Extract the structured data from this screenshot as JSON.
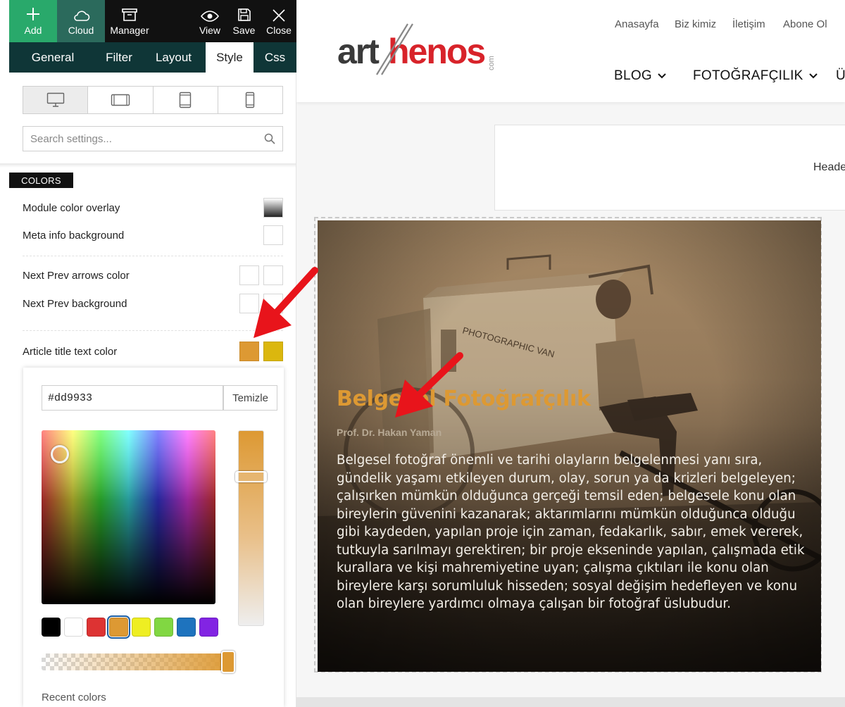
{
  "toolbar": {
    "add_label": "Add",
    "cloud_label": "Cloud",
    "manager_label": "Manager",
    "view_label": "View",
    "save_label": "Save",
    "close_label": "Close"
  },
  "tabs": [
    {
      "label": "General"
    },
    {
      "label": "Filter"
    },
    {
      "label": "Layout"
    },
    {
      "label": "Style",
      "active": true
    },
    {
      "label": "Css"
    }
  ],
  "devices": [
    {
      "icon": "desktop-icon",
      "active": true
    },
    {
      "icon": "tablet-landscape-icon"
    },
    {
      "icon": "tablet-portrait-icon"
    },
    {
      "icon": "phone-icon"
    }
  ],
  "search": {
    "placeholder": "Search settings..."
  },
  "section": {
    "label": "COLORS"
  },
  "settings": {
    "module_overlay": "Module color overlay",
    "meta_bg": "Meta info background",
    "arrows_color": "Next Prev arrows color",
    "arrows_bg": "Next Prev background",
    "title_color": "Article title text color"
  },
  "title_color_swatches": [
    "#dd9933",
    "#dbb70e"
  ],
  "picker": {
    "hex_value": "#dd9933",
    "clear_label": "Temizle",
    "palette": [
      "#000000",
      "#ffffff",
      "#dd3333",
      "#dd9933",
      "#eeee22",
      "#81d742",
      "#1e73be",
      "#8224e3"
    ],
    "selected": "#dd9933",
    "recent_label": "Recent colors"
  },
  "site": {
    "top_links": [
      "Anasayfa",
      "Biz kimiz",
      "İletişim",
      "Abone Ol"
    ],
    "nav": [
      "BLOG",
      "FOTOĞRAFÇILIK",
      "Ü"
    ],
    "header_box_text": "Heade",
    "logo": {
      "part1": "art",
      "part2": "henos",
      "suffix": "com"
    }
  },
  "article": {
    "title": "Belgesel Fotoğrafçılık",
    "author": "Prof. Dr. Hakan Yaman",
    "text": "Belgesel fotoğraf önemli ve tarihi olayların belgelenmesi yanı sıra, gündelik yaşamı etkileyen durum, olay, sorun ya da krizleri belgeleyen; çalışırken mümkün olduğunca gerçeği temsil eden; belgesele konu olan bireylerin güvenini kazanarak; aktarımlarını mümkün olduğunca olduğu gibi kaydeden, yapılan proje için zaman, fedakarlık, sabır, emek vererek, tutkuyla sarılmayı gerektiren; bir proje ekseninde yapılan, çalışmada etik kurallara ve kişi mahremiyetine uyan; çalışma çıktıları ile konu olan bireylere karşı sorumluluk hisseden; sosyal değişim hedefleyen ve konu olan bireylere yardımcı olmaya çalışan bir fotoğraf üslubudur.",
    "photo_caption": "PHOTOGRAPHIC VAN"
  },
  "colors": {
    "accent": "#dd9933",
    "topbar": "#111111",
    "tabs_bg": "#0f3637",
    "add_bg": "#29a96b",
    "cloud_bg": "#2b6a5c",
    "arrow": "#e8141b"
  }
}
